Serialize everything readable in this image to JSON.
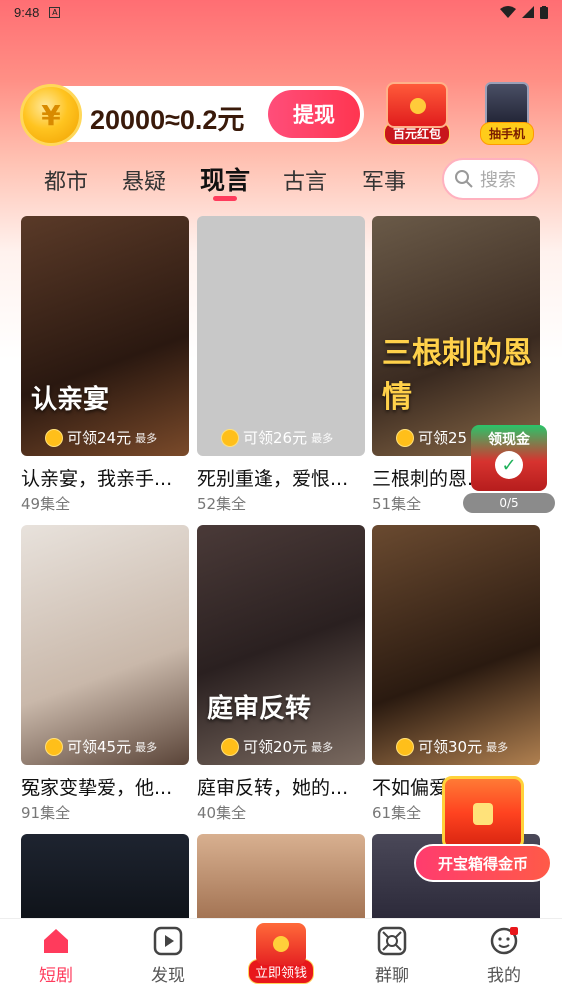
{
  "status_bar": {
    "time": "9:48",
    "notif": "A"
  },
  "coin_bar": {
    "text": "20000≈0.2元",
    "withdraw_label": "提现",
    "coin_symbol": "¥"
  },
  "promos": [
    {
      "label": "百元红包"
    },
    {
      "label": "抽手机"
    }
  ],
  "tabs": [
    "都市",
    "悬疑",
    "现言",
    "古言",
    "军事"
  ],
  "active_tab": "现言",
  "search": {
    "placeholder": "搜索"
  },
  "cards": [
    {
      "title": "认亲宴，我亲手...",
      "episodes": "49集全",
      "reward": "可领24元",
      "most": "最多",
      "poster_text": "认亲宴",
      "bg": "linear-gradient(160deg,#5a3a28,#2a1810 60%,#7a4a2a)"
    },
    {
      "title": "死别重逢，爱恨...",
      "episodes": "52集全",
      "reward": "可领26元",
      "most": "最多",
      "poster_text": "",
      "bg": "#c8c8c8"
    },
    {
      "title": "三根刺的恩...",
      "episodes": "51集全",
      "reward": "可领25",
      "most": "",
      "poster_text": "三根刺的恩情",
      "bg": "linear-gradient(160deg,#6a5a48,#3a2a20 60%,#8a6a48)"
    },
    {
      "title": "冤家变挚爱，他...",
      "episodes": "91集全",
      "reward": "可领45元",
      "most": "最多",
      "poster_text": "",
      "bg": "linear-gradient(160deg,#e8e2dc,#c9b8aa 60%,#5a4438)"
    },
    {
      "title": "庭审反转，她的...",
      "episodes": "40集全",
      "reward": "可领20元",
      "most": "最多",
      "poster_text": "庭审反转",
      "bg": "linear-gradient(160deg,#4a3a38,#2a2020 50%,#7a6a60)"
    },
    {
      "title": "不如偏爱...",
      "episodes": "61集全",
      "reward": "可领30元",
      "most": "最多",
      "poster_text": "",
      "bg": "linear-gradient(160deg,#6a4a30,#2a1a10 60%,#b08050)"
    },
    {
      "title": "",
      "episodes": "",
      "reward": "",
      "most": "",
      "poster_text": "",
      "bg": "linear-gradient(180deg,#1e2430,#0e1218)"
    },
    {
      "title": "",
      "episodes": "",
      "reward": "",
      "most": "",
      "poster_text": "",
      "bg": "linear-gradient(180deg,#d8b090,#a07050)"
    },
    {
      "title": "",
      "episodes": "",
      "reward": "",
      "most": "",
      "poster_text": "",
      "bg": "linear-gradient(180deg,#4a4858,#2a2838)"
    }
  ],
  "float_cash": {
    "label": "领现金",
    "progress": "0/5"
  },
  "chest": {
    "label": "开宝箱得金币"
  },
  "nav": {
    "items": [
      {
        "label": "短剧",
        "icon": "home-icon"
      },
      {
        "label": "发现",
        "icon": "play-icon"
      },
      {
        "label": "立即领钱",
        "icon": "red-envelope-icon"
      },
      {
        "label": "群聊",
        "icon": "group-icon"
      },
      {
        "label": "我的",
        "icon": "profile-icon"
      }
    ]
  },
  "colors": {
    "accent": "#ff3b5c",
    "header_top": "#ff6e73"
  }
}
